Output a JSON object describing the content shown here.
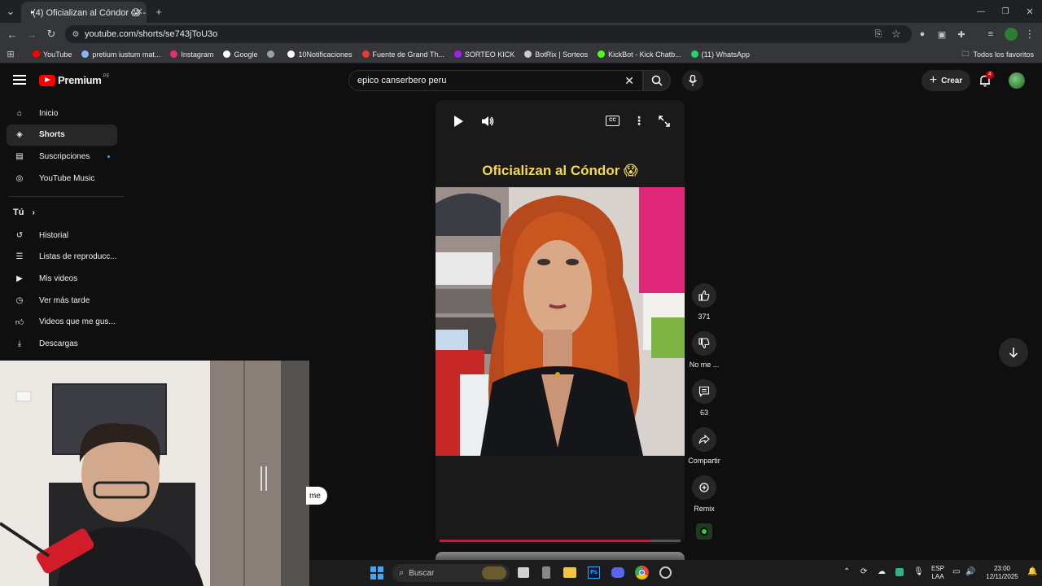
{
  "browser": {
    "tab_title": "(4) Oficializan al Cóndor 😱 - Y",
    "url": "youtube.com/shorts/se743jToU3o",
    "bookmarks": [
      {
        "label": "YouTube",
        "color": "#ff0000"
      },
      {
        "label": "pretium iustum mat...",
        "color": "#8ab4f8"
      },
      {
        "label": "Instagram",
        "color": "#e1306c"
      },
      {
        "label": "Google",
        "color": "#ffffff"
      },
      {
        "label": "",
        "color": "#9aa0a6"
      },
      {
        "label": "10Notificaciones",
        "color": "#ffffff"
      },
      {
        "label": "Fuente de Grand Th...",
        "color": "#e53935"
      },
      {
        "label": "SORTEO KICK",
        "color": "#a020f0"
      },
      {
        "label": "BotRix | Sorteos",
        "color": "#cccccc"
      },
      {
        "label": "KickBot - Kick Chatb...",
        "color": "#53fc18"
      },
      {
        "label": "(11) WhatsApp",
        "color": "#25d366"
      }
    ],
    "all_bookmarks": "Todos los favoritos"
  },
  "header": {
    "logo_text": "Premium",
    "region": "PE",
    "search_value": "epico canserbero peru",
    "create_label": "Crear",
    "notif_count": "4"
  },
  "sidebar": {
    "items": [
      {
        "label": "Inicio",
        "icon": "home-icon"
      },
      {
        "label": "Shorts",
        "icon": "shorts-icon"
      },
      {
        "label": "Suscripciones",
        "icon": "subscriptions-icon"
      },
      {
        "label": "YouTube Music",
        "icon": "music-icon"
      }
    ],
    "you_label": "Tú",
    "you_items": [
      {
        "label": "Historial",
        "icon": "history-icon"
      },
      {
        "label": "Listas de reproducc...",
        "icon": "playlist-icon"
      },
      {
        "label": "Mis videos",
        "icon": "my-videos-icon"
      },
      {
        "label": "Ver más tarde",
        "icon": "watch-later-icon"
      },
      {
        "label": "Videos que me gus...",
        "icon": "like-icon"
      },
      {
        "label": "Descargas",
        "icon": "download-icon"
      }
    ]
  },
  "short": {
    "title": "Oficializan al Cóndor 😱",
    "likes": "371",
    "dislike_label": "No me ...",
    "comments": "63",
    "share_label": "Compartir",
    "remix_label": "Remix",
    "progress": 0.88,
    "overlay_text": "me"
  },
  "taskbar": {
    "search_placeholder": "Buscar",
    "lang": "ESP",
    "layout": "LAA",
    "time": "23:00",
    "date": "12/11/2025"
  }
}
